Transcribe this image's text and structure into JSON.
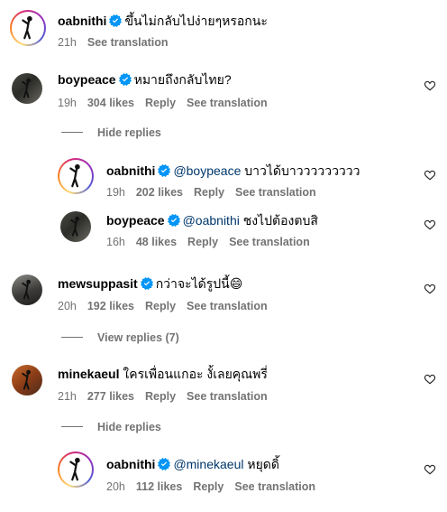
{
  "comments": [
    {
      "user": "oabnithi",
      "verified": true,
      "text": "ขึ้นไม่กลับไปง่ายๆหรอกนะ",
      "time": "21h",
      "see_translation": "See translation"
    },
    {
      "user": "boypeace",
      "verified": true,
      "text": "หมายถึงกลับไทย?",
      "time": "19h",
      "likes": "304 likes",
      "reply": "Reply",
      "see_translation": "See translation"
    },
    {
      "user": "oabnithi",
      "verified": true,
      "mention": "@boypeace",
      "text": "บาวได้บาววววววววว",
      "time": "19h",
      "likes": "202 likes",
      "reply": "Reply",
      "see_translation": "See translation"
    },
    {
      "user": "boypeace",
      "verified": true,
      "mention": "@oabnithi",
      "text": "ชงไปต้องตบสิ",
      "time": "16h",
      "likes": "48 likes",
      "reply": "Reply",
      "see_translation": "See translation"
    },
    {
      "user": "mewsuppasit",
      "verified": true,
      "text": "กว่าจะได้รูปนี้",
      "emoji": "😄",
      "time": "20h",
      "likes": "192 likes",
      "reply": "Reply",
      "see_translation": "See translation"
    },
    {
      "user": "minekaeul",
      "verified": false,
      "text": "ใครเพื่อนแกอะ งั้เลยคุณพรี่",
      "time": "21h",
      "likes": "277 likes",
      "reply": "Reply",
      "see_translation": "See translation"
    },
    {
      "user": "oabnithi",
      "verified": true,
      "mention": "@minekaeul",
      "text": "หยุดดิ้",
      "time": "20h",
      "likes": "112 likes",
      "reply": "Reply",
      "see_translation": "See translation"
    }
  ],
  "toggles": {
    "hide_replies_1": "Hide replies",
    "view_replies": "View replies (7)",
    "hide_replies_2": "Hide replies"
  },
  "colors": {
    "verified": "#0095f6",
    "meta": "#737373",
    "mention": "#00376b"
  }
}
